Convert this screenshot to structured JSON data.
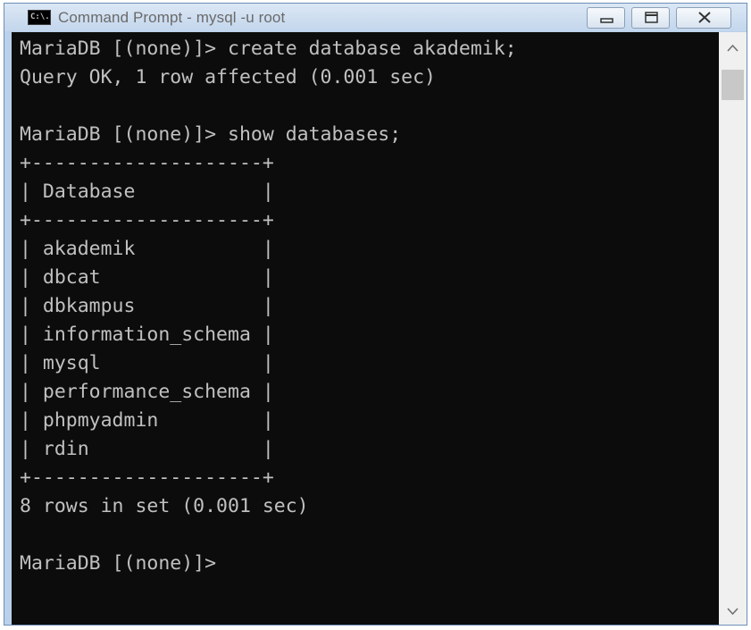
{
  "window": {
    "title": "Command Prompt - mysql  -u root",
    "icon_text": "C:\\."
  },
  "controls": {
    "minimize_icon": "minimize-icon",
    "maximize_icon": "maximize-icon",
    "close_icon": "close-icon"
  },
  "terminal": {
    "lines": [
      "MariaDB [(none)]> create database akademik;",
      "Query OK, 1 row affected (0.001 sec)",
      "",
      "MariaDB [(none)]> show databases;",
      "+--------------------+",
      "| Database           |",
      "+--------------------+",
      "| akademik           |",
      "| dbcat              |",
      "| dbkampus           |",
      "| information_schema |",
      "| mysql              |",
      "| performance_schema |",
      "| phpmyadmin         |",
      "| rdin               |",
      "+--------------------+",
      "8 rows in set (0.001 sec)",
      "",
      "MariaDB [(none)]>"
    ]
  },
  "colors": {
    "terminal_bg": "#0c0c0c",
    "terminal_fg": "#c0c0c0",
    "titlebar": "#c3d6ec"
  }
}
